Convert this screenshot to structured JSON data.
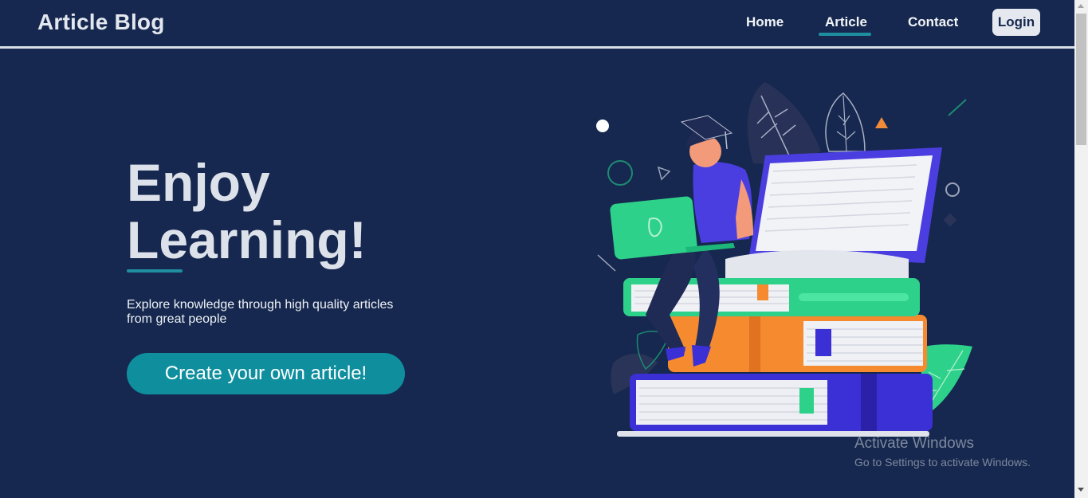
{
  "nav": {
    "brand": "Article Blog",
    "links": [
      {
        "label": "Home"
      },
      {
        "label": "Article"
      },
      {
        "label": "Contact"
      }
    ],
    "active_link": "Article",
    "login_label": "Login"
  },
  "hero": {
    "title_line1": "Enjoy",
    "title_line2": "Learning!",
    "subtitle": "Explore knowledge through high quality articles from great people",
    "cta_label": "Create your own article!"
  },
  "watermark": {
    "title": "Activate Windows",
    "subtitle": "Go to Settings to activate Windows."
  },
  "colors": {
    "background": "#16284f",
    "accent": "#1f8fa0",
    "cta": "#0f8f9e",
    "login_bg": "#e5e8ee"
  },
  "illustration": {
    "icons": [
      "student-reading-illustration",
      "laptop-icon",
      "book-stack-icon",
      "graduation-cap-icon",
      "leaf-icon"
    ]
  }
}
